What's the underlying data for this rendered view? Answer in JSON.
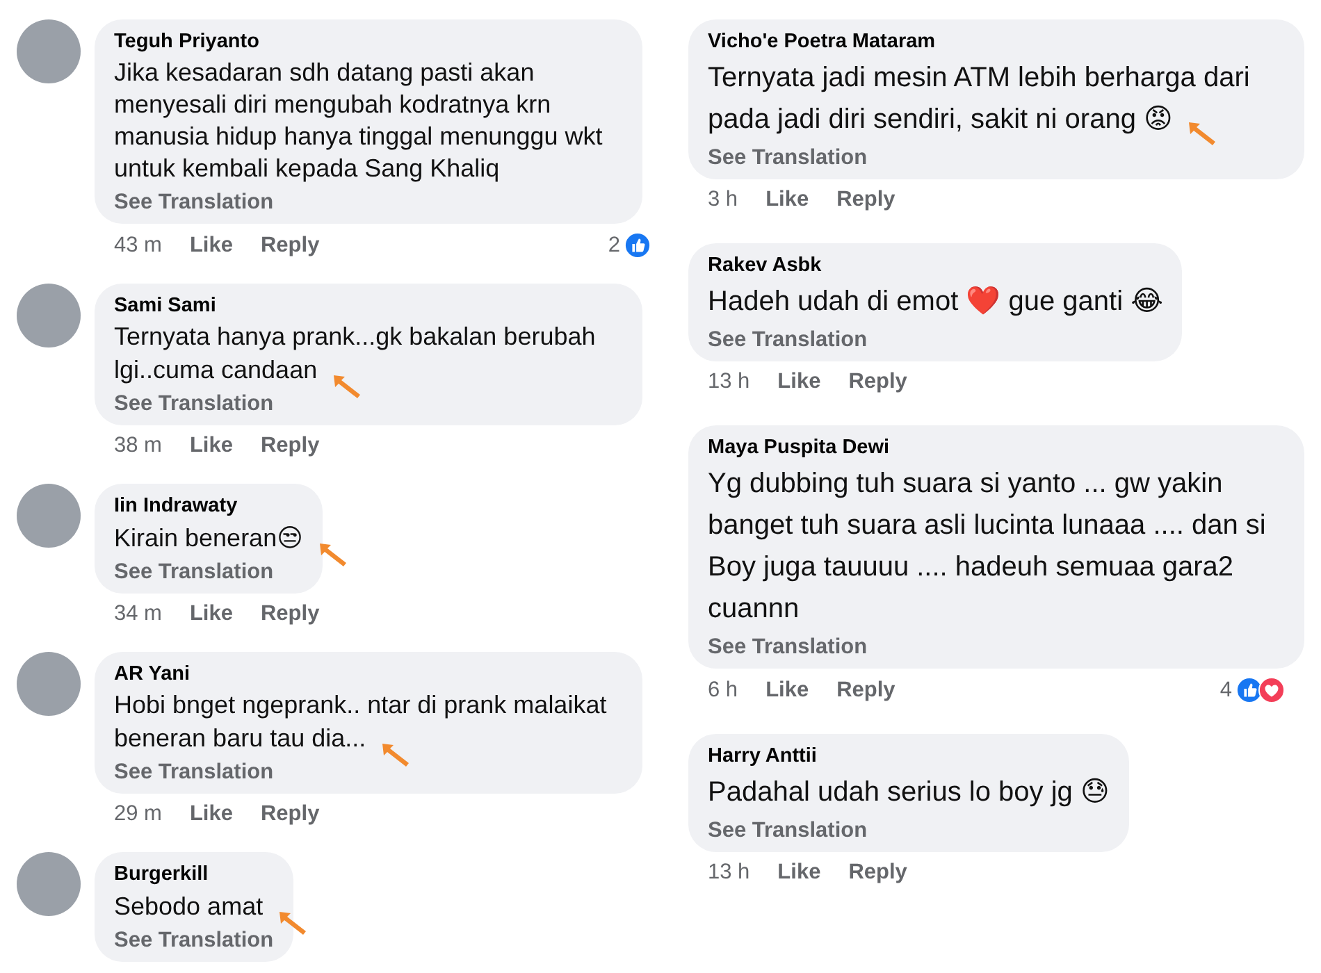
{
  "columns": [
    {
      "comments": [
        {
          "avatar": true,
          "author": "Teguh Priyanto",
          "text": "Jika kesadaran sdh datang pasti akan menyesali diri mengubah kodratnya krn manusia hidup hanya tinggal menunggu wkt untuk kembali kepada Sang Khaliq",
          "see_translation": "See Translation",
          "time": "43 m",
          "like": "Like",
          "reply": "Reply",
          "marked": false,
          "reaction_count": "2",
          "reactions": [
            {
              "kind": "like"
            }
          ]
        },
        {
          "avatar": true,
          "author": "Sami Sami",
          "text": "Ternyata hanya prank...gk bakalan berubah lgi..cuma candaan",
          "see_translation": "See Translation",
          "time": "38 m",
          "like": "Like",
          "reply": "Reply",
          "marked": true
        },
        {
          "avatar": true,
          "author": "Iin Indrawaty",
          "text": "Kirain beneran😒",
          "see_translation": "See Translation",
          "time": "34 m",
          "like": "Like",
          "reply": "Reply",
          "marked": true
        },
        {
          "avatar": true,
          "author": "AR Yani",
          "text": "Hobi bnget ngeprank.. ntar di prank malaikat beneran baru tau dia...",
          "see_translation": "See Translation",
          "time": "29 m",
          "like": "Like",
          "reply": "Reply",
          "marked": true
        },
        {
          "avatar": true,
          "author": "Burgerkill",
          "text": "Sebodo amat",
          "see_translation": "See Translation",
          "marked": true
        }
      ]
    },
    {
      "comments": [
        {
          "author": "Vicho'e Poetra Mataram",
          "text": "Ternyata jadi mesin ATM lebih berharga dari pada jadi diri sendiri, sakit ni orang 😡",
          "see_translation": "See Translation",
          "time": "3 h",
          "like": "Like",
          "reply": "Reply",
          "marked": true
        },
        {
          "author": "Rakev Asbk",
          "text": "Hadeh udah di emot ❤️ gue ganti 😂",
          "see_translation": "See Translation",
          "time": "13 h",
          "like": "Like",
          "reply": "Reply",
          "marked": false
        },
        {
          "author": "Maya Puspita Dewi",
          "text": "Yg dubbing tuh suara si yanto ... gw yakin banget tuh suara asli lucinta lunaaa .... dan si Boy juga tauuuu .... hadeuh semuaa gara2 cuannn",
          "see_translation": "See Translation",
          "time": "6 h",
          "like": "Like",
          "reply": "Reply",
          "marked": false,
          "reaction_count": "4",
          "reactions": [
            {
              "kind": "like"
            },
            {
              "kind": "love"
            }
          ]
        },
        {
          "author": "Harry Anttii",
          "text": "Padahal udah serius lo boy jg 😓",
          "see_translation": "See Translation",
          "time": "13 h",
          "like": "Like",
          "reply": "Reply",
          "marked": false
        }
      ]
    }
  ]
}
